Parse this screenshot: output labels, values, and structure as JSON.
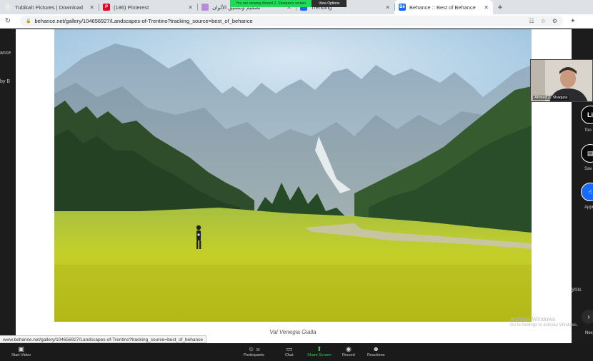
{
  "browser": {
    "tabs": [
      {
        "label": "Tubikah Pictures | Download",
        "favicon_color": "#e5e5e5",
        "favicon_text": "t",
        "active": false
      },
      {
        "label": "(186) Pinterest",
        "favicon_color": "#e60023",
        "favicon_text": "P",
        "active": false
      },
      {
        "label": "تصميم وتنسيق الألوان",
        "favicon_color": "#b98ad8",
        "favicon_text": "",
        "active": false
      },
      {
        "label": "Trending",
        "favicon_color": "#1769ff",
        "favicon_text": "",
        "active": false
      },
      {
        "label": "Behance :: Best of Behance",
        "favicon_color": "#1769ff",
        "favicon_text": "Bē",
        "active": true
      }
    ],
    "address_url": "behance.net/gallery/104656927/Landscapes-of-Trentino?tracking_source=best_of_behance",
    "status_url": "www.behance.net/gallery/104656927/Landscapes-of-Trentino?tracking_source=best_of_behance"
  },
  "zoom": {
    "banner_message": "You are viewing Ahmed Z. Shaqura's screen",
    "banner_options": "View Options",
    "presenter_name": "Ahmed Z. Shaqura",
    "toolbar": {
      "start_video": "Start Video",
      "participants": "Participants",
      "participants_count": "36",
      "chat": "Chat",
      "share_screen": "Share Screen",
      "record": "Record",
      "reactions": "Reactions"
    },
    "accent": "#23d959"
  },
  "behance": {
    "caption": "Val Venegia Gialla",
    "rail": [
      {
        "label": "Too",
        "icon": "toolbox-icon",
        "color": "#0b0b0b"
      },
      {
        "label": "Sav",
        "icon": "folder-icon",
        "color": "#0b0b0b"
      },
      {
        "label": "Appre",
        "icon": "thumbs-up-icon",
        "color": "#1769ff"
      }
    ],
    "next_label": "Nex"
  },
  "windows": {
    "activate_title": "Activate Windows",
    "activate_sub": "Go to Settings to activate Windows."
  },
  "background_fragments": [
    "ance",
    "by B",
    "you."
  ]
}
